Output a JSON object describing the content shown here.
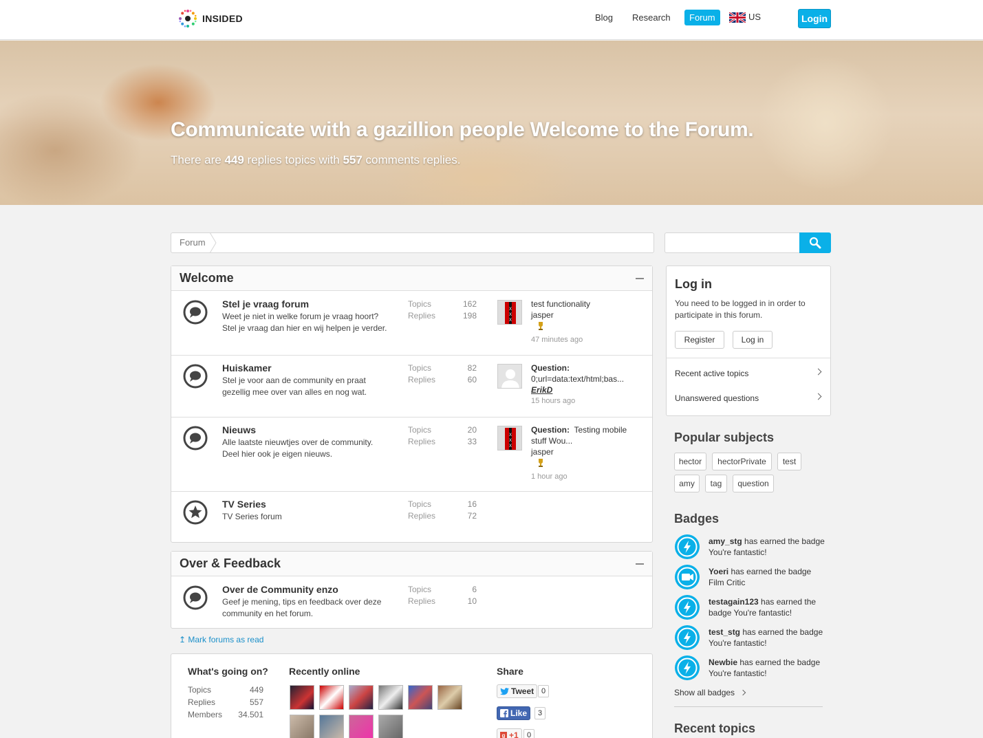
{
  "header": {
    "logo_text": "INSIDED",
    "nav": {
      "blog": "Blog",
      "research": "Research",
      "forum": "Forum",
      "locale": "US"
    },
    "login": "Login"
  },
  "hero": {
    "title": "Communicate with a gazillion people Welcome to the Forum.",
    "sub_prefix": "There are ",
    "topics_count": "449",
    "sub_mid": " replies topics with ",
    "comments_count": "557",
    "sub_suffix": " comments replies."
  },
  "breadcrumb": {
    "forum": "Forum"
  },
  "search": {
    "placeholder": ""
  },
  "sections": [
    {
      "title": "Welcome",
      "forums": [
        {
          "name": "Stel je vraag forum",
          "desc": "Weet je niet in welke forum je vraag hoort? Stel je vraag dan hier en wij helpen je verder.",
          "topics_label": "Topics",
          "topics": "162",
          "replies_label": "Replies",
          "replies": "198",
          "last_q": "",
          "last_title": "test functionality",
          "last_user": "jasper",
          "last_time": "47 minutes ago"
        },
        {
          "name": "Huiskamer",
          "desc": "Stel je voor aan de community en praat gezellig mee over van alles en nog wat.",
          "topics_label": "Topics",
          "topics": "82",
          "replies_label": "Replies",
          "replies": "60",
          "last_q": "Question:",
          "last_title": "0;url=data:text/html;bas...",
          "last_user": "ErikD",
          "last_time": "15 hours ago"
        },
        {
          "name": "Nieuws",
          "desc": "Alle laatste nieuwtjes over de community. Deel hier ook je eigen nieuws.",
          "topics_label": "Topics",
          "topics": "20",
          "replies_label": "Replies",
          "replies": "33",
          "last_q": "Question:",
          "last_title": "Testing mobile stuff Wou...",
          "last_user": "jasper",
          "last_time": "1 hour ago"
        },
        {
          "name": "TV Series",
          "desc": "TV Series forum",
          "topics_label": "Topics",
          "topics": "16",
          "replies_label": "Replies",
          "replies": "72"
        }
      ]
    },
    {
      "title": "Over & Feedback",
      "forums": [
        {
          "name": "Over de Community enzo",
          "desc": "Geef je mening, tips en feedback over deze community en het forum.",
          "topics_label": "Topics",
          "topics": "6",
          "replies_label": "Replies",
          "replies": "10"
        }
      ]
    }
  ],
  "mark_read": "Mark forums as read",
  "stats": {
    "heading": "What's going on?",
    "rows": [
      {
        "label": "Topics",
        "value": "449"
      },
      {
        "label": "Replies",
        "value": "557"
      },
      {
        "label": "Members",
        "value": "34.501"
      }
    ]
  },
  "recently_online": {
    "heading": "Recently online"
  },
  "share": {
    "heading": "Share",
    "tweet": "Tweet",
    "tweet_count": "0",
    "like": "Like",
    "like_count": "3",
    "gplus": "+1",
    "gplus_count": "0"
  },
  "login_panel": {
    "title": "Log in",
    "text": "You need to be logged in in order to participate in this forum.",
    "register": "Register",
    "login": "Log in",
    "links": [
      "Recent active topics",
      "Unanswered questions"
    ]
  },
  "popular": {
    "heading": "Popular subjects",
    "tags": [
      "hector",
      "hectorPrivate",
      "test",
      "amy",
      "tag",
      "question"
    ]
  },
  "badges": {
    "heading": "Badges",
    "items": [
      {
        "user": "amy_stg",
        "text": " has earned the badge You're fantastic!",
        "icon": "lightning-icon"
      },
      {
        "user": "Yoeri",
        "text": " has earned the badge Film Critic",
        "icon": "camera-icon"
      },
      {
        "user": "testagain123",
        "text": " has earned the badge You're fantastic!",
        "icon": "lightning-icon"
      },
      {
        "user": "test_stg",
        "text": " has earned the badge You're fantastic!",
        "icon": "lightning-icon"
      },
      {
        "user": "Newbie",
        "text": " has earned the badge You're fantastic!",
        "icon": "lightning-icon"
      }
    ],
    "show_all": "Show all badges"
  },
  "recent_topics": {
    "heading": "Recent topics"
  },
  "colors": {
    "accent": "#0ab0e8",
    "link": "#1a8fc9"
  }
}
